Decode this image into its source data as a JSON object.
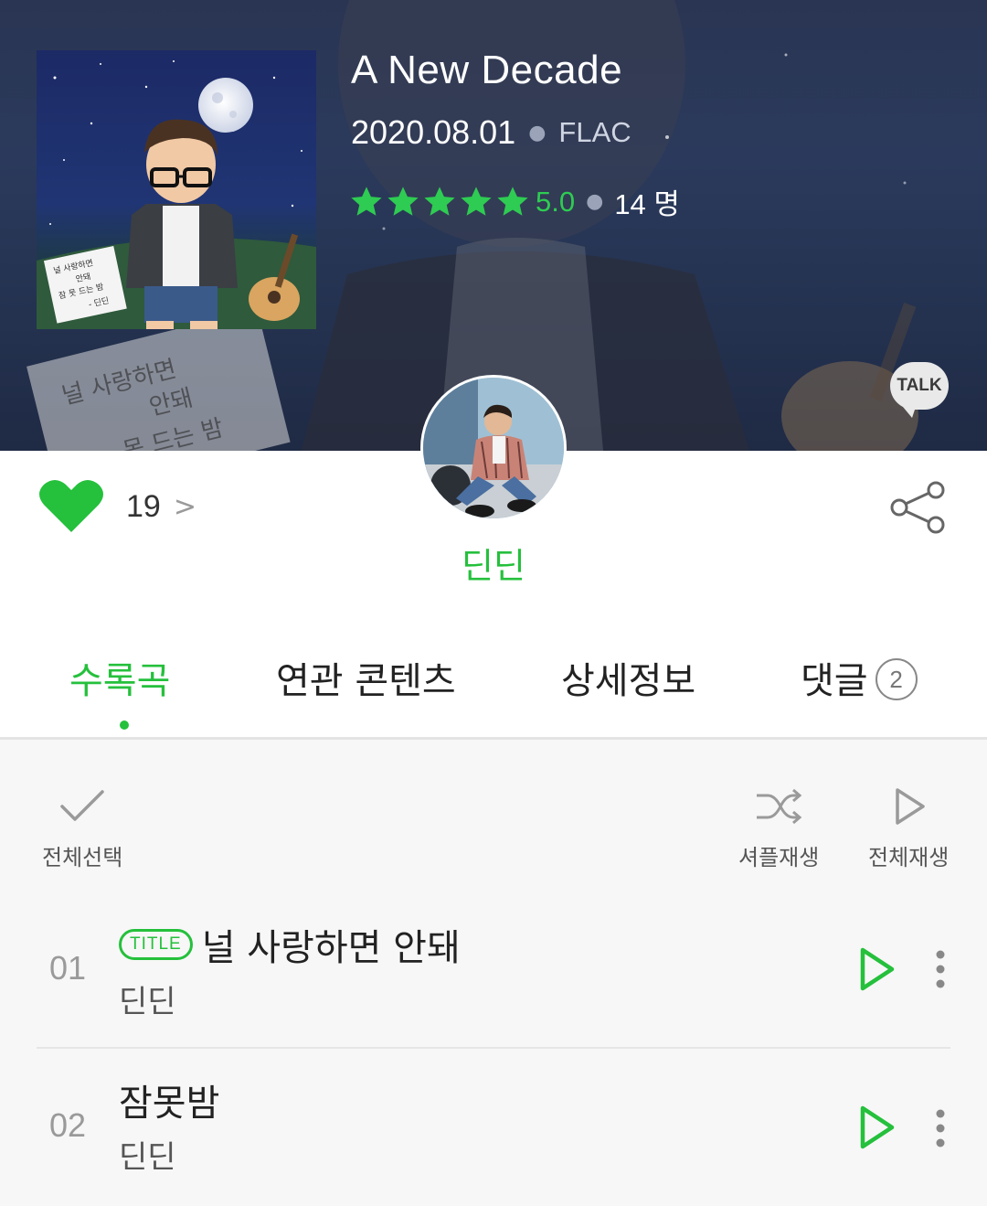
{
  "album": {
    "title": "A New Decade",
    "release_date": "2020.08.01",
    "format": "FLAC",
    "rating": "5.0",
    "rating_count": "14 명",
    "stars": 5,
    "cover_note_text": [
      "널 사랑하면",
      "안돼",
      "잠 못 드는 밤",
      "- 딘딘"
    ],
    "background_note_text": [
      "널 사랑하면",
      "안돼",
      "못 드는 밤"
    ]
  },
  "talk": {
    "label": "TALK"
  },
  "artist": {
    "name": "딘딘"
  },
  "like": {
    "count": "19",
    "chevron": ">"
  },
  "tabs": [
    {
      "label": "수록곡",
      "active": true
    },
    {
      "label": "연관 콘텐츠",
      "active": false
    },
    {
      "label": "상세정보",
      "active": false
    },
    {
      "label": "댓글",
      "active": false,
      "badge": "2"
    }
  ],
  "toolbar": {
    "select_all": "전체선택",
    "shuffle": "셔플재생",
    "play_all": "전체재생"
  },
  "tracks": [
    {
      "no": "01",
      "badge": "TITLE",
      "title": "널 사랑하면 안돼",
      "artist": "딘딘"
    },
    {
      "no": "02",
      "badge": "",
      "title": "잠못밤",
      "artist": "딘딘"
    }
  ],
  "colors": {
    "accent": "#25c03c",
    "star": "#2ecc52",
    "hero_bg": "#2b3a5c"
  }
}
